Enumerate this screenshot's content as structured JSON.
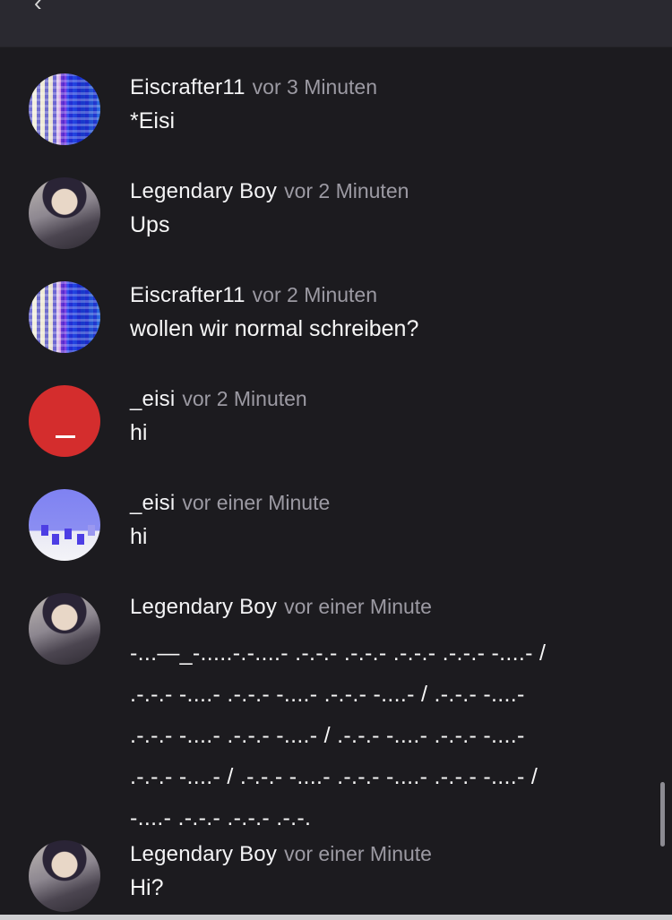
{
  "header": {
    "back_glyph": "‹"
  },
  "messages": [
    {
      "author": "Eiscrafter11",
      "time": "vor 3 Minuten",
      "text": "*Eisi",
      "avatar": "pixel-avatar"
    },
    {
      "author": "Legendary Boy",
      "time": "vor 2 Minuten",
      "text": "Ups",
      "avatar": "anime-avatar"
    },
    {
      "author": "Eiscrafter11",
      "time": "vor 2 Minuten",
      "text": "wollen wir normal schreiben?",
      "avatar": "pixel-avatar"
    },
    {
      "author": "_eisi",
      "time": "vor 2 Minuten",
      "text": "hi",
      "avatar": "red-avatar",
      "avatar_letter": "_"
    },
    {
      "author": "_eisi",
      "time": "vor einer Minute",
      "text": "hi",
      "avatar": "blue-pixel-avatar"
    },
    {
      "author": "Legendary Boy",
      "time": "vor einer Minute",
      "text": "-...—_-.....-.-....- .-.-.- .-.-.- .-.-.- .-.-.- -....- /\n.-.-.- -....- .-.-.- -....- .-.-.- -....- / .-.-.- -....-\n.-.-.- -....- .-.-.- -....- / .-.-.- -....- .-.-.- -....-\n.-.-.- -....- / .-.-.- -....- .-.-.- -....- .-.-.- -....- /\n-....- .-.-.- .-.-.- .-.-.",
      "avatar": "anime-avatar"
    },
    {
      "author": "Legendary Boy",
      "time": "vor einer Minute",
      "text": "Hi?",
      "avatar": "anime-avatar"
    }
  ],
  "colors": {
    "background": "#1c1b1f",
    "header": "#2a2930",
    "timestamp": "#9c9aa3",
    "red_avatar": "#d42d2d"
  }
}
